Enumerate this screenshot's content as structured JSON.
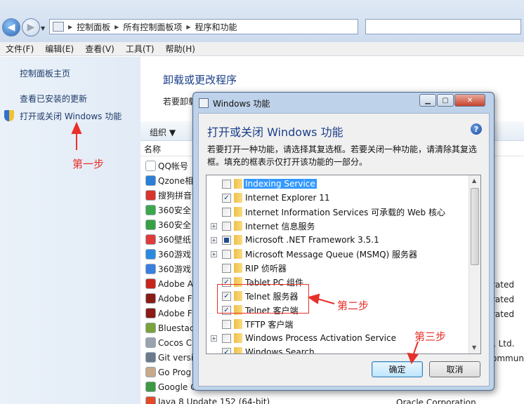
{
  "address_bar": {
    "breadcrumb": [
      "控制面板",
      "所有控制面板项",
      "程序和功能"
    ]
  },
  "menubar": {
    "items": [
      "文件(F)",
      "编辑(E)",
      "查看(V)",
      "工具(T)",
      "帮助(H)"
    ]
  },
  "left_pane": {
    "links": [
      "控制面板主页",
      "查看已安装的更新",
      "打开或关闭 Windows 功能"
    ]
  },
  "main": {
    "title": "卸载或更改程序",
    "description": "若要卸载",
    "organize_label": "组织 ▼",
    "column_name": "名称",
    "programs": [
      {
        "name": "QQ帐号",
        "color": "#ffffff"
      },
      {
        "name": "Qzone相",
        "color": "#2b7fd6"
      },
      {
        "name": "搜狗拼音",
        "color": "#d9332b"
      },
      {
        "name": "360安全",
        "color": "#3aa84a"
      },
      {
        "name": "360安全",
        "color": "#36a143"
      },
      {
        "name": "360壁纸",
        "color": "#e03a3a"
      },
      {
        "name": "360游戏",
        "color": "#2a8ae0"
      },
      {
        "name": "360游戏",
        "color": "#3a7fe0"
      },
      {
        "name": "Adobe A",
        "color": "#c8251c"
      },
      {
        "name": "Adobe F",
        "color": "#8a1b15"
      },
      {
        "name": "Adobe F",
        "color": "#8a1b15"
      },
      {
        "name": "Bluestac",
        "color": "#7aa33a"
      },
      {
        "name": "Cocos C",
        "color": "#9aa2ad"
      },
      {
        "name": "Git versi",
        "color": "#6b7b8c"
      },
      {
        "name": "Go Prog",
        "color": "#c7a98a"
      },
      {
        "name": "Google C",
        "color": "#3d9a40"
      },
      {
        "name": "Java 8 Update 152 (64-bit)",
        "color": "#e24a2a"
      }
    ],
    "publisher_fragments": [
      "rated",
      "rated",
      "rated",
      "o., Ltd.",
      "ommuni",
      "Oracle Corporation"
    ]
  },
  "dialog": {
    "title": "Windows 功能",
    "heading": "打开或关闭 Windows 功能",
    "intro": "若要打开一种功能，请选择其复选框。若要关闭一种功能，请清除其复选框。填充的框表示仅打开该功能的一部分。",
    "features": [
      {
        "label": "Indexing Service",
        "state": "unchecked",
        "expandable": false,
        "selected": true
      },
      {
        "label": "Internet Explorer 11",
        "state": "checked",
        "expandable": false
      },
      {
        "label": "Internet Information Services 可承载的 Web 核心",
        "state": "unchecked",
        "expandable": false
      },
      {
        "label": "Internet 信息服务",
        "state": "unchecked",
        "expandable": true
      },
      {
        "label": "Microsoft .NET Framework 3.5.1",
        "state": "partial",
        "expandable": true
      },
      {
        "label": "Microsoft Message Queue (MSMQ) 服务器",
        "state": "unchecked",
        "expandable": true
      },
      {
        "label": "RIP 侦听器",
        "state": "unchecked",
        "expandable": false
      },
      {
        "label": "Tablet PC 组件",
        "state": "checked",
        "expandable": false
      },
      {
        "label": "Telnet 服务器",
        "state": "checked",
        "expandable": false
      },
      {
        "label": "Telnet 客户端",
        "state": "checked",
        "expandable": false
      },
      {
        "label": "TFTP 客户端",
        "state": "unchecked",
        "expandable": false
      },
      {
        "label": "Windows Process Activation Service",
        "state": "unchecked",
        "expandable": true
      },
      {
        "label": "Windows Search",
        "state": "checked",
        "expandable": false
      }
    ],
    "ok_label": "确定",
    "cancel_label": "取消"
  },
  "annotations": {
    "step1": "第一步",
    "step2": "第二步",
    "step3": "第三步",
    "color": "#e8302a"
  }
}
